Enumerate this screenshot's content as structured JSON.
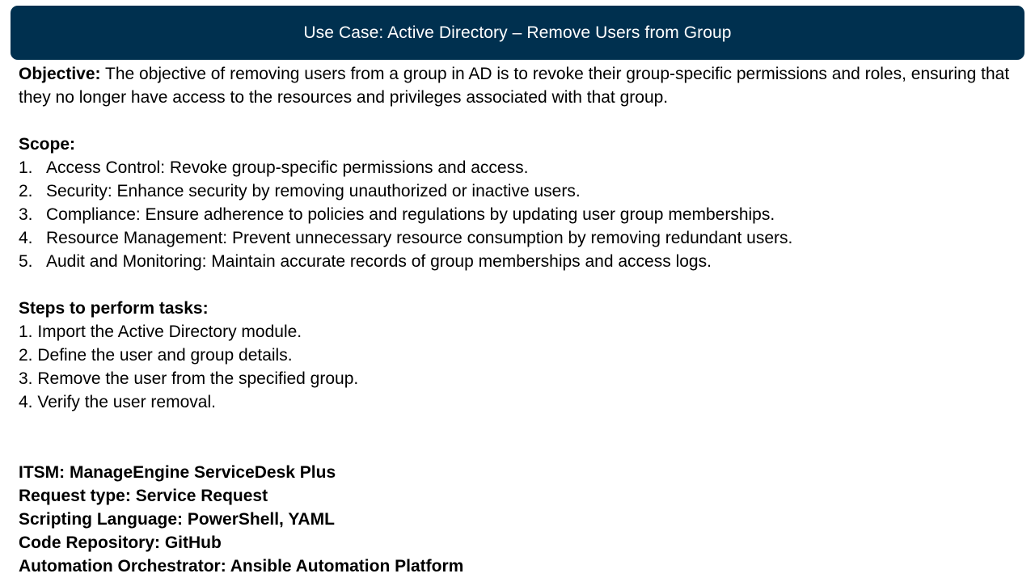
{
  "title": "Use Case: Active Directory – Remove Users from Group",
  "objective": {
    "label": "Objective:",
    "text": " The objective of removing users from a group in AD is to revoke their group-specific permissions and roles, ensuring that they no longer have access to the resources and privileges associated with that group."
  },
  "scope": {
    "heading": "Scope:",
    "items": [
      {
        "num": "1.",
        "text": "Access Control: Revoke group-specific permissions and access."
      },
      {
        "num": "2.",
        "text": "Security: Enhance security by removing unauthorized or inactive users."
      },
      {
        "num": "3.",
        "text": "Compliance: Ensure adherence to policies and regulations by updating user group memberships."
      },
      {
        "num": "4.",
        "text": "Resource Management: Prevent unnecessary resource consumption by removing redundant users."
      },
      {
        "num": "5.",
        "text": "Audit and Monitoring: Maintain accurate records of group memberships and access logs."
      }
    ]
  },
  "steps": {
    "heading": "Steps to perform tasks:",
    "items": [
      "1. Import the Active Directory module.",
      "2. Define the user and group details.",
      "3. Remove the user from the specified group.",
      "4. Verify the user removal."
    ]
  },
  "meta": {
    "itsm": "ITSM: ManageEngine ServiceDesk Plus",
    "request_type": "Request type: Service Request",
    "scripting_language": "Scripting Language: PowerShell, YAML",
    "code_repository": "Code Repository: GitHub",
    "automation_orchestrator": "Automation Orchestrator: Ansible Automation Platform"
  },
  "colors": {
    "title_bar": "#00304f",
    "title_text": "#ffffff",
    "body_text": "#000000"
  }
}
